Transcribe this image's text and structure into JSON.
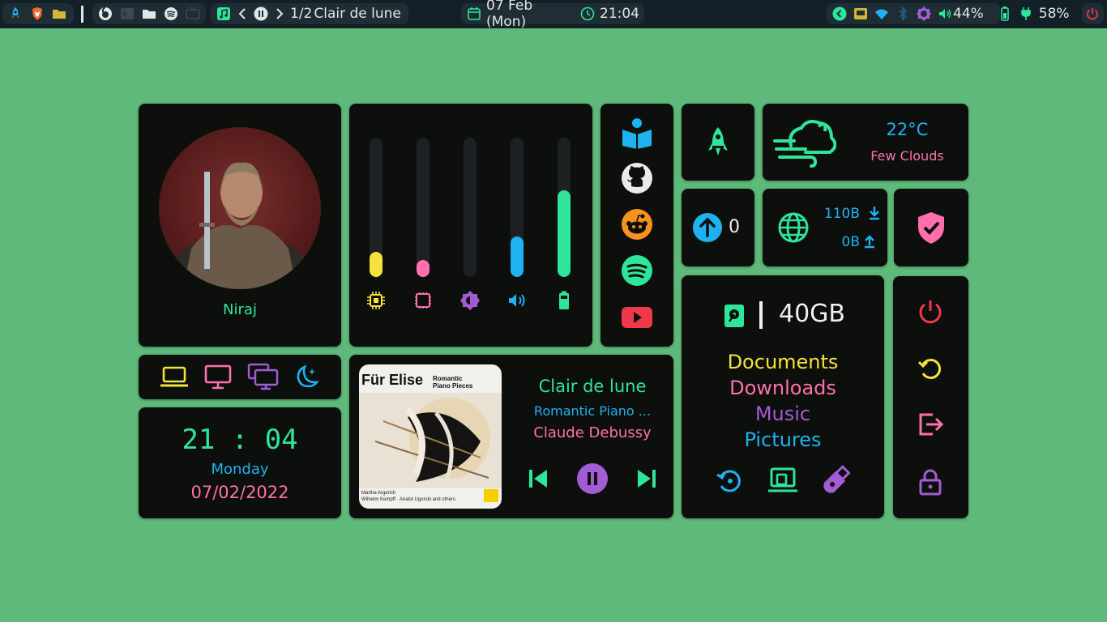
{
  "topbar": {
    "media": {
      "track_position": "1/2",
      "track_title": "Clair de lune"
    },
    "datetime": {
      "date": "07 Feb (Mon)",
      "time": "21:04"
    },
    "status": {
      "volume": "44%",
      "battery": "58%"
    }
  },
  "profile": {
    "name": "Niraj"
  },
  "sliders": [
    {
      "name": "cpu",
      "level": 0.18,
      "color": "#f5e23c"
    },
    {
      "name": "ram",
      "level": 0.12,
      "color": "#ff6fae"
    },
    {
      "name": "brightness",
      "level": 0.0,
      "color": "#a45bd6"
    },
    {
      "name": "volume",
      "level": 0.29,
      "color": "#1fb2f2"
    },
    {
      "name": "battery",
      "level": 0.62,
      "color": "#2ee59a"
    }
  ],
  "weather": {
    "temperature": "22°C",
    "description": "Few Clouds"
  },
  "updates": {
    "count": "0"
  },
  "network": {
    "download": "110B",
    "upload": "0B"
  },
  "storage": {
    "free": "40GB",
    "folders": [
      "Documents",
      "Downloads",
      "Music",
      "Pictures"
    ]
  },
  "clock": {
    "time": "21 : 04",
    "day": "Monday",
    "date": "07/02/2022"
  },
  "player": {
    "title": "Clair de lune",
    "album": "Romantic Piano ...",
    "artist": "Claude Debussy",
    "cover": {
      "title": "Für Elise",
      "subtitle_line1": "Romantic",
      "subtitle_line2": "Piano Pieces",
      "credits_line1": "Martha Argerich",
      "credits_line2": "Wilhelm Kempff · Anatol Ugorski and others"
    }
  },
  "colors": {
    "green": "#2ee59a",
    "blue": "#1fb2f2",
    "pink": "#ff6fae",
    "yellow": "#f5e23c",
    "purple": "#a45bd6",
    "red": "#f0384b",
    "bg": "#5eb97a"
  }
}
